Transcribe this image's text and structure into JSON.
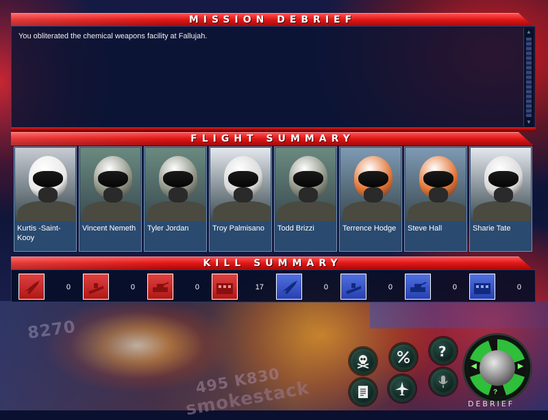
{
  "mission_debrief": {
    "title": "MISSION DEBRIEF",
    "text": "You obliterated the chemical weapons facility at Fallujah."
  },
  "flight_summary": {
    "title": "FLIGHT SUMMARY",
    "pilots": [
      {
        "name": "Kurtis -Saint-Kooy",
        "helmet": "#e8e8e8",
        "sky": "#c8ccd4"
      },
      {
        "name": "Vincent Nemeth",
        "helmet": "#8a8f80",
        "sky": "#6a8a80"
      },
      {
        "name": "Tyler Jordan",
        "helmet": "#8a8f80",
        "sky": "#6a8a80"
      },
      {
        "name": "Troy Palmisano",
        "helmet": "#d8d8d8",
        "sky": "#e4e8ee"
      },
      {
        "name": "Todd Brizzi",
        "helmet": "#8a8f80",
        "sky": "#6a8a80"
      },
      {
        "name": "Terrence Hodge",
        "helmet": "#e07030",
        "sky": "#7e9ab4"
      },
      {
        "name": "Steve Hall",
        "helmet": "#e07030",
        "sky": "#7e9ab4"
      },
      {
        "name": "Sharie Tate",
        "helmet": "#d8d8d8",
        "sky": "#e4e8ee"
      }
    ]
  },
  "kill_summary": {
    "title": "KILL SUMMARY",
    "items": [
      {
        "icon": "enemy-aircraft-icon",
        "side": "red",
        "count": "0"
      },
      {
        "icon": "enemy-ship-icon",
        "side": "red",
        "count": "0"
      },
      {
        "icon": "enemy-tank-icon",
        "side": "red",
        "count": "0"
      },
      {
        "icon": "enemy-building-icon",
        "side": "red",
        "count": "17"
      },
      {
        "icon": "friendly-aircraft-icon",
        "side": "blue",
        "count": "0"
      },
      {
        "icon": "friendly-ship-icon",
        "side": "blue",
        "count": "0"
      },
      {
        "icon": "friendly-tank-icon",
        "side": "blue",
        "count": "0"
      },
      {
        "icon": "friendly-building-icon",
        "side": "blue",
        "count": "0"
      }
    ]
  },
  "background": {
    "text1": "8270",
    "text2": "495 K830",
    "text3": "smokestack"
  },
  "controls": {
    "dial_label": "DEBRIEF"
  },
  "colors": {
    "panel_red": "#e01818",
    "enemy_red": "#d03030",
    "friendly_blue": "#4060d0",
    "dial_green": "#2fbf3a"
  }
}
